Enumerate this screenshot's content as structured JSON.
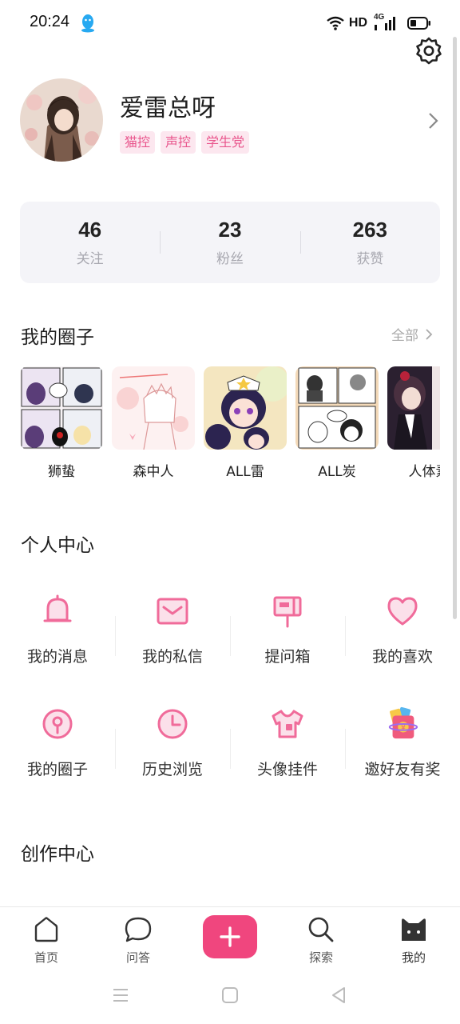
{
  "status_bar": {
    "time": "20:24",
    "network": "HD",
    "signal": "4G"
  },
  "profile": {
    "username": "爱雷总呀",
    "tags": [
      "猫控",
      "声控",
      "学生党"
    ]
  },
  "stats": [
    {
      "value": "46",
      "label": "关注"
    },
    {
      "value": "23",
      "label": "粉丝"
    },
    {
      "value": "263",
      "label": "获赞"
    }
  ],
  "circles_section": {
    "title": "我的圈子",
    "all_label": "全部",
    "items": [
      {
        "name": "狮蛰"
      },
      {
        "name": "森中人"
      },
      {
        "name": "ALL雷"
      },
      {
        "name": "ALL炭"
      },
      {
        "name": "人体素"
      }
    ]
  },
  "personal_center": {
    "title": "个人中心",
    "row1": [
      {
        "label": "我的消息",
        "icon": "bell-icon"
      },
      {
        "label": "我的私信",
        "icon": "mail-icon"
      },
      {
        "label": "提问箱",
        "icon": "mailbox-icon"
      },
      {
        "label": "我的喜欢",
        "icon": "heart-icon"
      }
    ],
    "row2": [
      {
        "label": "我的圈子",
        "icon": "circle-pin-icon"
      },
      {
        "label": "历史浏览",
        "icon": "clock-icon"
      },
      {
        "label": "头像挂件",
        "icon": "tshirt-icon"
      },
      {
        "label": "邀好友有奖",
        "icon": "red-envelope-icon"
      }
    ]
  },
  "creation_center": {
    "title": "创作中心"
  },
  "bottom_nav": {
    "items": [
      {
        "label": "首页",
        "icon": "home-icon"
      },
      {
        "label": "问答",
        "icon": "chat-bubble-icon"
      },
      {
        "label": "探索",
        "icon": "search-icon"
      },
      {
        "label": "我的",
        "icon": "cat-icon"
      }
    ],
    "publish_icon": "plus-icon"
  },
  "colors": {
    "accent": "#f0467e",
    "icon_pink": "#f06b9a",
    "tag_bg": "#fce7ef"
  }
}
